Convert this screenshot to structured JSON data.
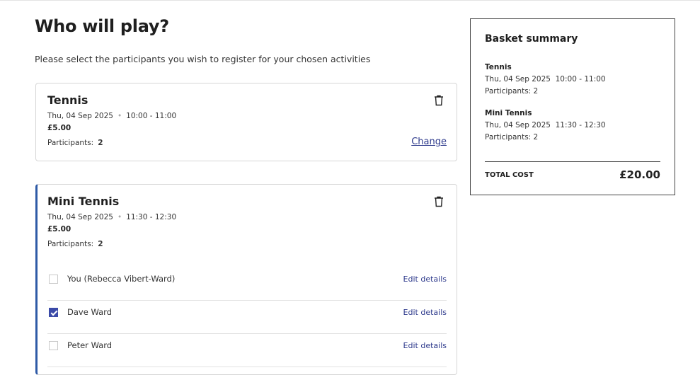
{
  "page": {
    "title": "Who will play?",
    "subtitle": "Please select the participants you wish to register for your chosen activities"
  },
  "activities": [
    {
      "name": "Tennis",
      "date": "Thu, 04 Sep 2025",
      "time": "10:00 - 11:00",
      "price": "£5.00",
      "participants_label": "Participants:",
      "participants_count": "2",
      "change_label": "Change"
    },
    {
      "name": "Mini Tennis",
      "date": "Thu, 04 Sep 2025",
      "time": "11:30 - 12:30",
      "price": "£5.00",
      "participants_label": "Participants:",
      "participants_count": "2",
      "participants": [
        {
          "name": "You (Rebecca Vibert-Ward)",
          "checked": false,
          "edit_label": "Edit details"
        },
        {
          "name": "Dave Ward",
          "checked": true,
          "edit_label": "Edit details"
        },
        {
          "name": "Peter Ward",
          "checked": false,
          "edit_label": "Edit details"
        }
      ]
    }
  ],
  "basket": {
    "title": "Basket summary",
    "items": [
      {
        "name": "Tennis",
        "datetime": "Thu, 04 Sep 2025  10:00 - 11:00",
        "participants": "Participants: 2"
      },
      {
        "name": "Mini Tennis",
        "datetime": "Thu, 04 Sep 2025  11:30 - 12:30",
        "participants": "Participants: 2"
      }
    ],
    "total_label": "TOTAL COST",
    "total_value": "£20.00"
  },
  "icons": {
    "delete": "trash-icon",
    "checkbox_checked": "checkmark-icon"
  },
  "colors": {
    "accent": "#2e5aa6",
    "link": "#2e3a8c",
    "checkbox": "#3b4aa8"
  }
}
